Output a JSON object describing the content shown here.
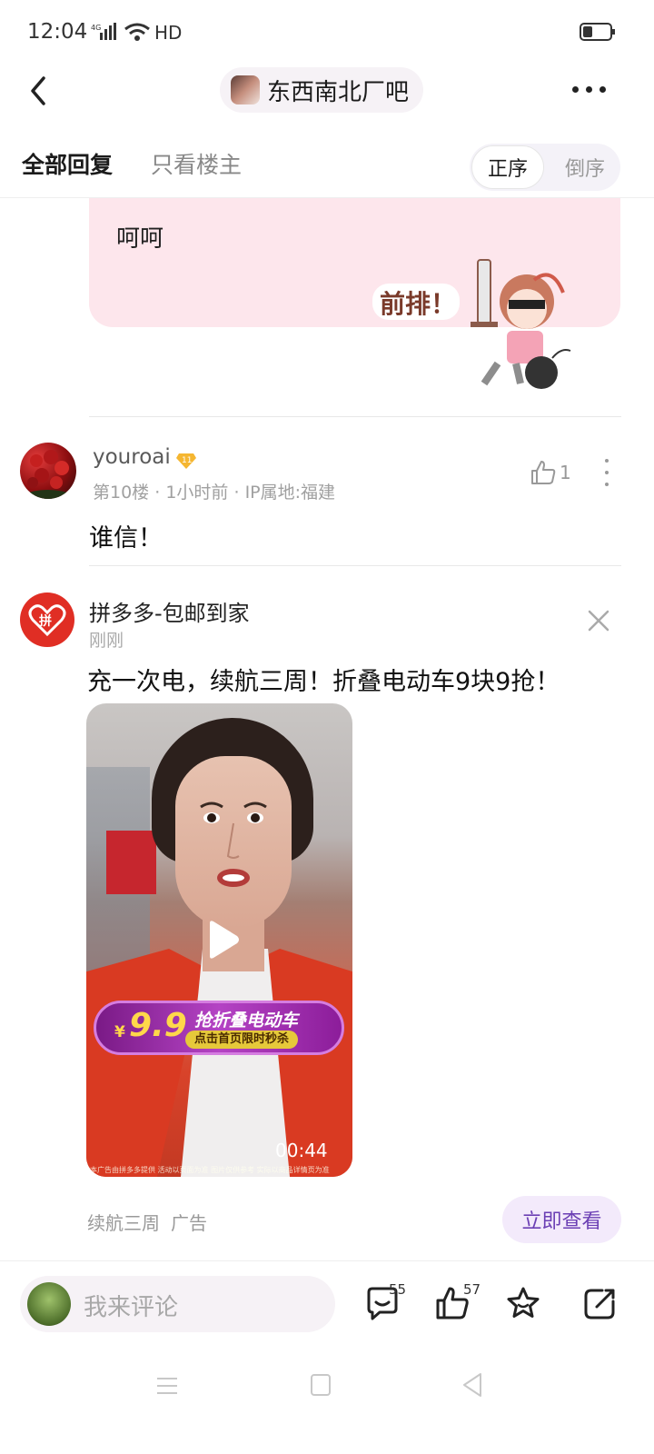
{
  "status_bar": {
    "time": "12:04",
    "network": "HD"
  },
  "nav": {
    "forum_name": "东西南北厂吧"
  },
  "tabs": {
    "all": "全部回复",
    "op_only": "只看楼主",
    "asc": "正序",
    "desc": "倒序"
  },
  "prev_reply": {
    "text": "呵呵",
    "sticker_text": "前排！"
  },
  "comment": {
    "username": "youroai",
    "level": "11",
    "floor": "第10楼",
    "time": "1小时前",
    "ip": "IP属地:福建",
    "like_count": "1",
    "text": "谁信！"
  },
  "ad": {
    "advertiser": "拼多多-包邮到家",
    "time": "刚刚",
    "title": "充一次电，续航三周！折叠电动车9块9抢！",
    "video": {
      "price_symbol": "¥",
      "price": "9.9",
      "slogan": "抢折叠电动车",
      "sub": "点击首页限时秒杀",
      "duration": "00:44",
      "fine_print": "本广告由拼多多提供 活动以页面为准 图片仅供参考 实际以商品详情页为准"
    },
    "desc": "续航三周",
    "tag": "广告",
    "cta": "立即查看",
    "logo_char": "拼"
  },
  "bottom_bar": {
    "placeholder": "我来评论",
    "comment_count": "55",
    "like_count": "57"
  },
  "colors": {
    "accent": "#6b3fb4",
    "pink_bubble": "#fde6ec",
    "pdd_red": "#e02e24"
  }
}
